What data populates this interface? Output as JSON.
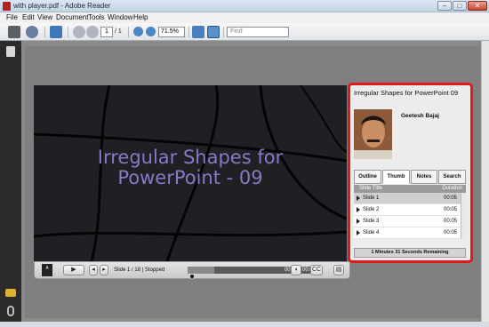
{
  "window": {
    "title": "with player.pdf - Adobe Reader"
  },
  "menu": [
    "File",
    "Edit",
    "View",
    "Document",
    "Tools",
    "Window",
    "Help"
  ],
  "toolbar": {
    "page_current": "1",
    "page_total": "/ 1",
    "zoom": "71.5%",
    "find_placeholder": "Find"
  },
  "slide": {
    "title_line1": "Irregular Shapes for",
    "title_line2": "PowerPoint - 09"
  },
  "player": {
    "status": "Slide 1 / 18 | Stopped",
    "time": "00:02 / 00:05",
    "progress_fraction": 0.2,
    "play_label": "▶",
    "cc_label": "CC"
  },
  "sidebar": {
    "title": "Irregular Shapes for PowerPoint 09",
    "presenter": "Geetesh Bajaj",
    "tabs": [
      "Outline",
      "Thumb",
      "Notes",
      "Search"
    ],
    "column_title": "Slide Title",
    "column_duration": "Duration",
    "slides": [
      {
        "name": "Slide 1",
        "duration": "00:05"
      },
      {
        "name": "Slide 2",
        "duration": "00:05"
      },
      {
        "name": "Slide 3",
        "duration": "00:05"
      },
      {
        "name": "Slide 4",
        "duration": "00:05"
      }
    ],
    "remaining": "1 Minutes 31 Seconds Remaining"
  },
  "colors": {
    "highlight": "#e01a1a",
    "slide_title": "#8a78c6",
    "slide_bg": "#1e2024"
  }
}
